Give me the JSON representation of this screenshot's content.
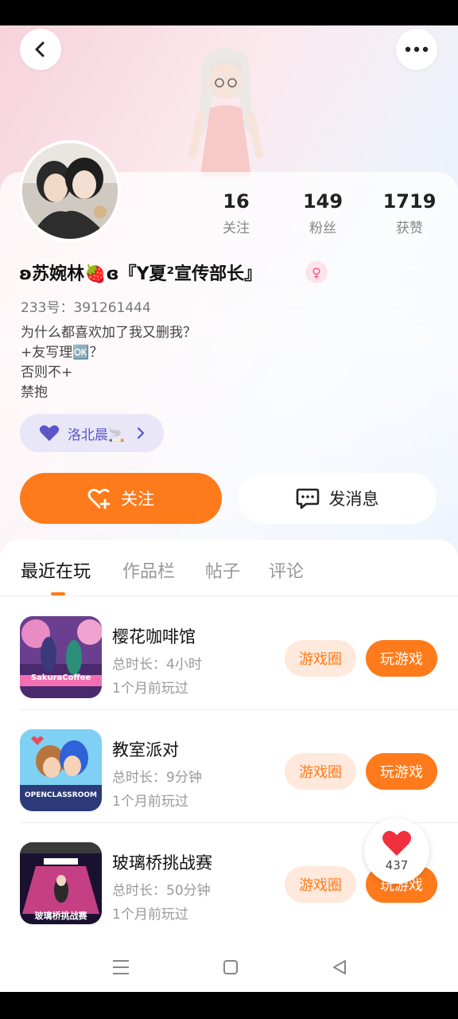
{
  "header": {
    "back_icon": "chevron-left-icon",
    "more_icon": "more-dots-icon"
  },
  "stats": [
    {
      "value": "16",
      "label": "关注"
    },
    {
      "value": "149",
      "label": "粉丝"
    },
    {
      "value": "1719",
      "label": "获赞"
    }
  ],
  "profile": {
    "nickname": "ʚ苏婉林🍓ɞ『Y夏²宣传部长』",
    "gender": "female",
    "uid": "233号：391261444",
    "bio_lines": [
      "为什么都喜欢加了我又删我？",
      "+友写理🆗？",
      "否则不+",
      "禁抱"
    ],
    "tag": "洛北晨🚬"
  },
  "actions": {
    "follow_label": "关注",
    "message_label": "发消息"
  },
  "tabs": [
    "最近在玩",
    "作品栏",
    "帖子",
    "评论"
  ],
  "games": [
    {
      "name": "樱花咖啡馆",
      "duration": "总时长：4小时",
      "last_played": "1个月前玩过",
      "circle_label": "游戏圈",
      "play_label": "玩游戏",
      "thumb_text": "SakuraCoffee"
    },
    {
      "name": "教室派对",
      "duration": "总时长：9分钟",
      "last_played": "1个月前玩过",
      "circle_label": "游戏圈",
      "play_label": "玩游戏",
      "thumb_text": "OPENCLASSROOM"
    },
    {
      "name": "玻璃桥挑战赛",
      "duration": "总时长：50分钟",
      "last_played": "1个月前玩过",
      "circle_label": "游戏圈",
      "play_label": "玩游戏",
      "thumb_text": "玻璃桥挑战赛"
    }
  ],
  "like_float": {
    "count": "437"
  },
  "colors": {
    "accent": "#ff7a1a",
    "accent_light": "#ffe9dc",
    "tag_purple": "#5b55c8"
  }
}
